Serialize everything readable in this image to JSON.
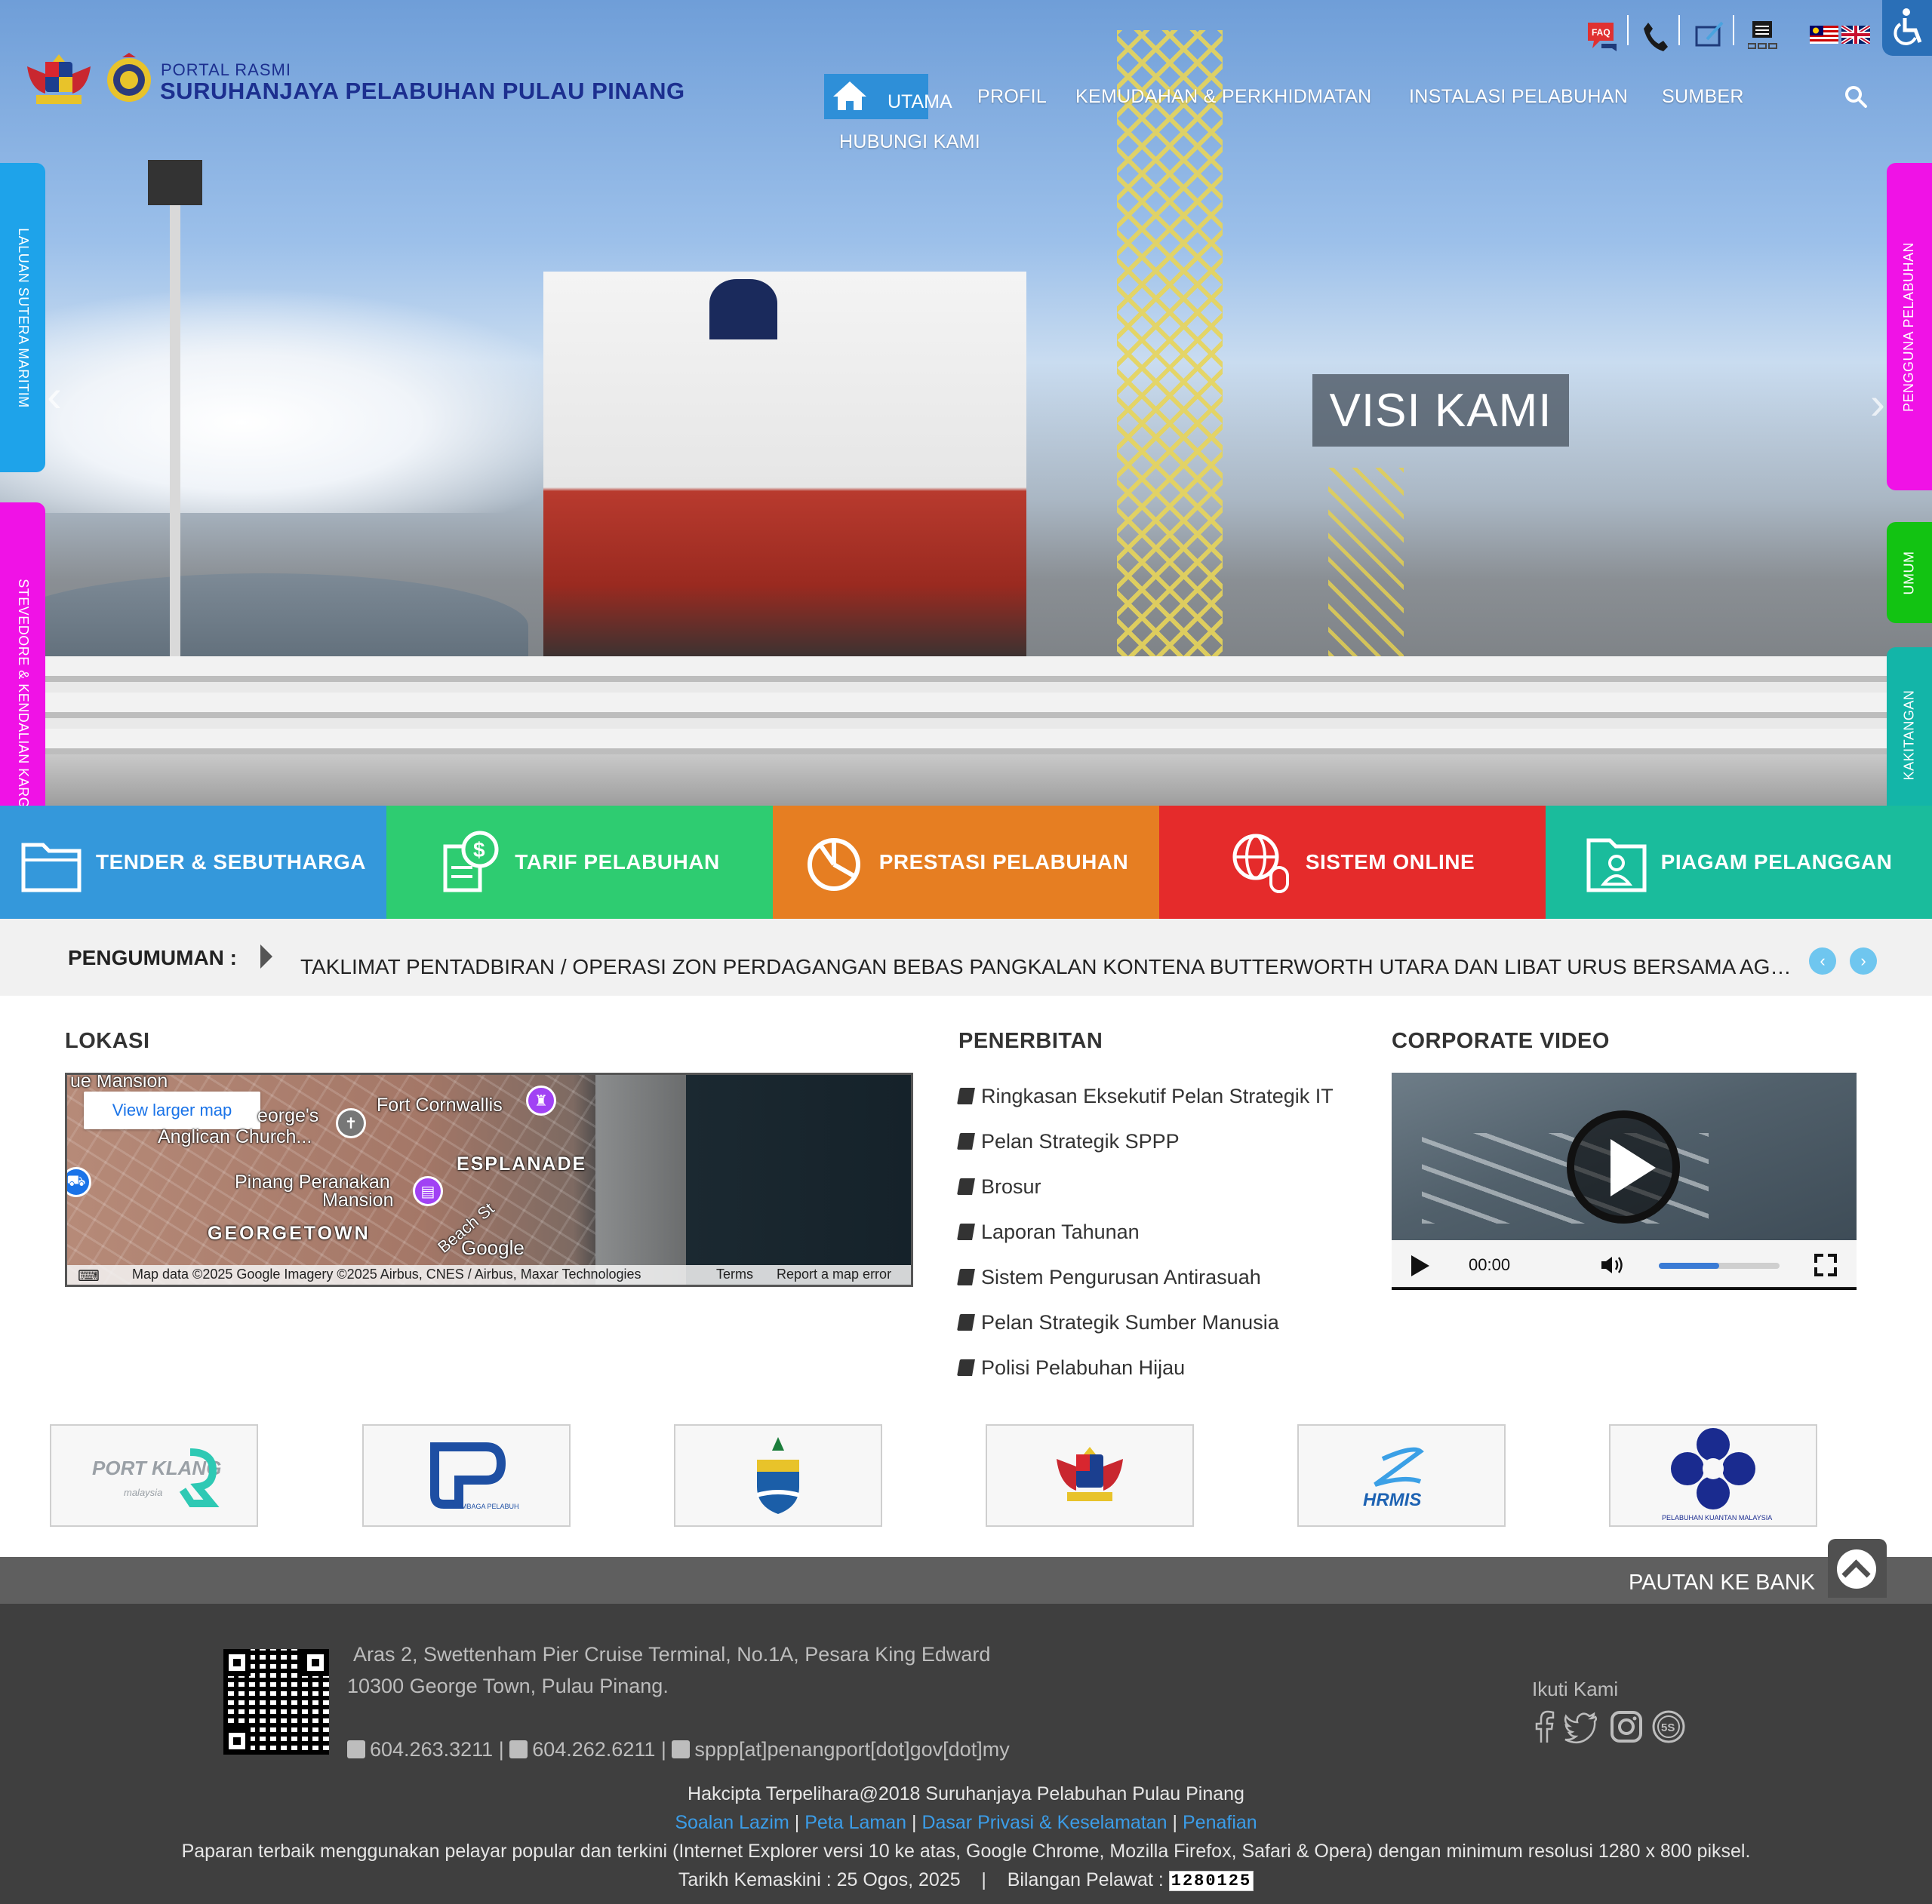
{
  "header": {
    "portal_small": "PORTAL RASMI",
    "portal_title": "SURUHANJAYA PELABUHAN PULAU PINANG",
    "nav": [
      {
        "label": "UTAMA",
        "active": true
      },
      {
        "label": "PROFIL"
      },
      {
        "label": "KEMUDAHAN & PERKHIDMATAN"
      },
      {
        "label": "INSTALASI PELABUHAN"
      },
      {
        "label": "SUMBER"
      },
      {
        "label": "HUBUNGI KAMI"
      }
    ],
    "faq_badge": "FAQ",
    "top_icons": [
      "faq-icon",
      "phone-icon",
      "feedback-icon",
      "sitemap-icon",
      "malaysia-flag-icon",
      "uk-flag-icon",
      "accessibility-icon"
    ]
  },
  "side_tabs": {
    "left": [
      "LALUAN SUTERA MARITIM",
      "STEVEDORE & KENDALIAN KARGO"
    ],
    "right": [
      "PENGGUNA PELABUHAN",
      "UMUM",
      "KAKITANGAN"
    ]
  },
  "hero": {
    "caption": "VISI KAMI"
  },
  "tiles": [
    {
      "label": "TENDER & SEBUTHARGA",
      "icon": "folder-icon",
      "color": "#3498db"
    },
    {
      "label": "TARIF PELABUHAN",
      "icon": "invoice-dollar-icon",
      "color": "#2ecc71"
    },
    {
      "label": "PRESTASI PELABUHAN",
      "icon": "pie-chart-icon",
      "color": "#e67e22"
    },
    {
      "label": "SISTEM ONLINE",
      "icon": "globe-mouse-icon",
      "color": "#e52b2b"
    },
    {
      "label": "PIAGAM PELANGGAN",
      "icon": "user-folder-icon",
      "color": "#1abc9c"
    }
  ],
  "announcement": {
    "label": "PENGUMUMAN :",
    "text": "TAKLIMAT PENTADBIRAN / OPERASI ZON PERDAGANGAN BEBAS PANGKALAN KONTENA BUTTERWORTH UTARA DAN LIBAT URUS BERSAMA AGENSI KERAJAAN"
  },
  "lokasi": {
    "title": "LOKASI",
    "map": {
      "button": "View larger map",
      "labels": [
        "ue Mansion",
        "Fort Cornwallis",
        "eorge's",
        "Anglican Church...",
        "ESPLANADE",
        "Pinang Peranakan",
        "Mansion",
        "GEORGETOWN",
        "Beach St",
        "Google"
      ],
      "footer_data": "Map data ©2025 Google Imagery ©2025 Airbus, CNES / Airbus, Maxar Technologies",
      "footer_terms": "Terms",
      "footer_report": "Report a map error"
    }
  },
  "penerbitan": {
    "title": "PENERBITAN",
    "items": [
      "Ringkasan Eksekutif Pelan Strategik IT",
      "Pelan Strategik SPPP",
      "Brosur",
      "Laporan Tahunan",
      "Sistem Pengurusan Antirasuah",
      "Pelan Strategik Sumber Manusia",
      "Polisi Pelabuhan Hijau"
    ]
  },
  "video": {
    "title": "CORPORATE VIDEO",
    "time": "00:00",
    "volume_level": 0.5
  },
  "partners": [
    {
      "name": "port-klang-logo",
      "text": "PORT KLANG",
      "sub": "malaysia"
    },
    {
      "name": "johor-port-logo",
      "text": "LEMBAGA PELABUHAN JOHOR"
    },
    {
      "name": "penang-state-logo"
    },
    {
      "name": "malaysia-crest-logo"
    },
    {
      "name": "hrmis-logo",
      "text": "HRMIS"
    },
    {
      "name": "kuantan-port-logo",
      "text": "PELABUHAN KUANTAN MALAYSIA"
    }
  ],
  "bank": {
    "label": "PAUTAN KE BANK"
  },
  "footer": {
    "address_line1": "Aras 2, Swettenham Pier Cruise Terminal, No.1A, Pesara King Edward",
    "address_line2": "10300 George Town, Pulau Pinang.",
    "phone": "604.263.3211",
    "fax": "604.262.6211",
    "email": "sppp[at]penangport[dot]gov[dot]my",
    "follow": "Ikuti Kami",
    "social": [
      "facebook-icon",
      "twitter-icon",
      "instagram-icon",
      "5s-icon"
    ],
    "copyright": "Hakcipta Terpelihara@2018 Suruhanjaya Pelabuhan Pulau Pinang",
    "links": [
      "Soalan Lazim",
      "Peta Laman",
      "Dasar Privasi & Keselamatan",
      "Penafian"
    ],
    "browser_note": "Paparan terbaik menggunakan pelayar popular dan terkini (Internet Explorer versi 10 ke atas, Google Chrome, Mozilla Firefox, Safari & Opera) dengan minimum resolusi 1280 x 800 piksel.",
    "updated": "Tarikh Kemaskini : 25 Ogos, 2025",
    "visitors_label": "Bilangan Pelawat :",
    "visitors": "1280125"
  }
}
